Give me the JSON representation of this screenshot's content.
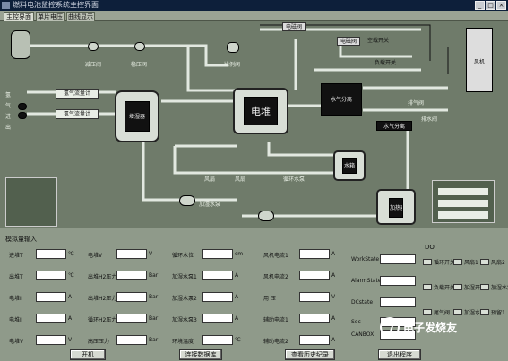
{
  "window": {
    "title": "燃料电池监控系统主控界面"
  },
  "tabs": [
    {
      "label": "主控界面"
    },
    {
      "label": "单片电压"
    },
    {
      "label": "曲线显示"
    }
  ],
  "diagram": {
    "valves_top": [
      "减压阀",
      "稳压阀",
      "比例阀"
    ],
    "tank_label": "电",
    "humid_label": "增湿器",
    "gas_in": [
      "氢",
      "气",
      "进",
      "出"
    ],
    "flow_boxes": [
      "氢气流量计",
      "氢气流量计"
    ],
    "stack_label": "电堆",
    "top_boxes": [
      "电磁阀",
      "电磁阀"
    ],
    "top_right": [
      "空载开关",
      "负载开关",
      "风机"
    ],
    "separator1": "水气分离",
    "separator2": "水气分离",
    "purge": [
      "排气阀",
      "排水阀"
    ],
    "loop_labels": [
      "风扇",
      "风扇",
      "循环水泵"
    ],
    "water_tank": "水箱",
    "pump_labels": [
      "加湿水泵"
    ],
    "heater": "加热器"
  },
  "panel": {
    "title": "模拟量输入",
    "fields": [
      {
        "label": "进堆T",
        "unit": "℃"
      },
      {
        "label": "出堆T",
        "unit": "℃"
      },
      {
        "label": "电堆I",
        "unit": "A"
      },
      {
        "label": "电堆I",
        "unit": "A"
      },
      {
        "label": "电堆V",
        "unit": "V"
      },
      {
        "label": "电堆V",
        "unit": "V"
      },
      {
        "label": "出堆H2压力",
        "unit": "Bar"
      },
      {
        "label": "出堆H2压力",
        "unit": "Bar"
      },
      {
        "label": "循环H2压力",
        "unit": "Bar"
      },
      {
        "label": "高压压力",
        "unit": "Bar"
      },
      {
        "label": "循环水位",
        "unit": "cm"
      },
      {
        "label": "加湿水泵1",
        "unit": "A"
      },
      {
        "label": "加湿水泵2",
        "unit": "A"
      },
      {
        "label": "加湿水泵3",
        "unit": "A"
      },
      {
        "label": "环境温度",
        "unit": "℃"
      },
      {
        "label": "风机电流1",
        "unit": "A"
      },
      {
        "label": "风机电流2",
        "unit": "A"
      },
      {
        "label": "用 压",
        "unit": "V"
      },
      {
        "label": "辅助电流1",
        "unit": "A"
      },
      {
        "label": "辅助电流2",
        "unit": "A"
      }
    ],
    "status_fields": [
      "WorkState",
      "AlarmState",
      "DCstate",
      "Soc",
      "CANBOX"
    ],
    "do_title": "DO",
    "do_items": [
      "循环开关",
      "风扇1",
      "风扇2",
      "负载开关",
      "加湿开关",
      "加湿水泵",
      "尾气阀",
      "加湿水泵",
      "预留1",
      "尾气阀",
      "预留",
      "预留2"
    ],
    "buttons": [
      "开机",
      "连接数据库",
      "查看历史纪录",
      "退出程序"
    ]
  },
  "watermark": "电子发烧友",
  "colors": {
    "background": "#8f9a8a",
    "diagram_bg": "#6f7b6a",
    "titlebar": "#0d1f3a"
  }
}
